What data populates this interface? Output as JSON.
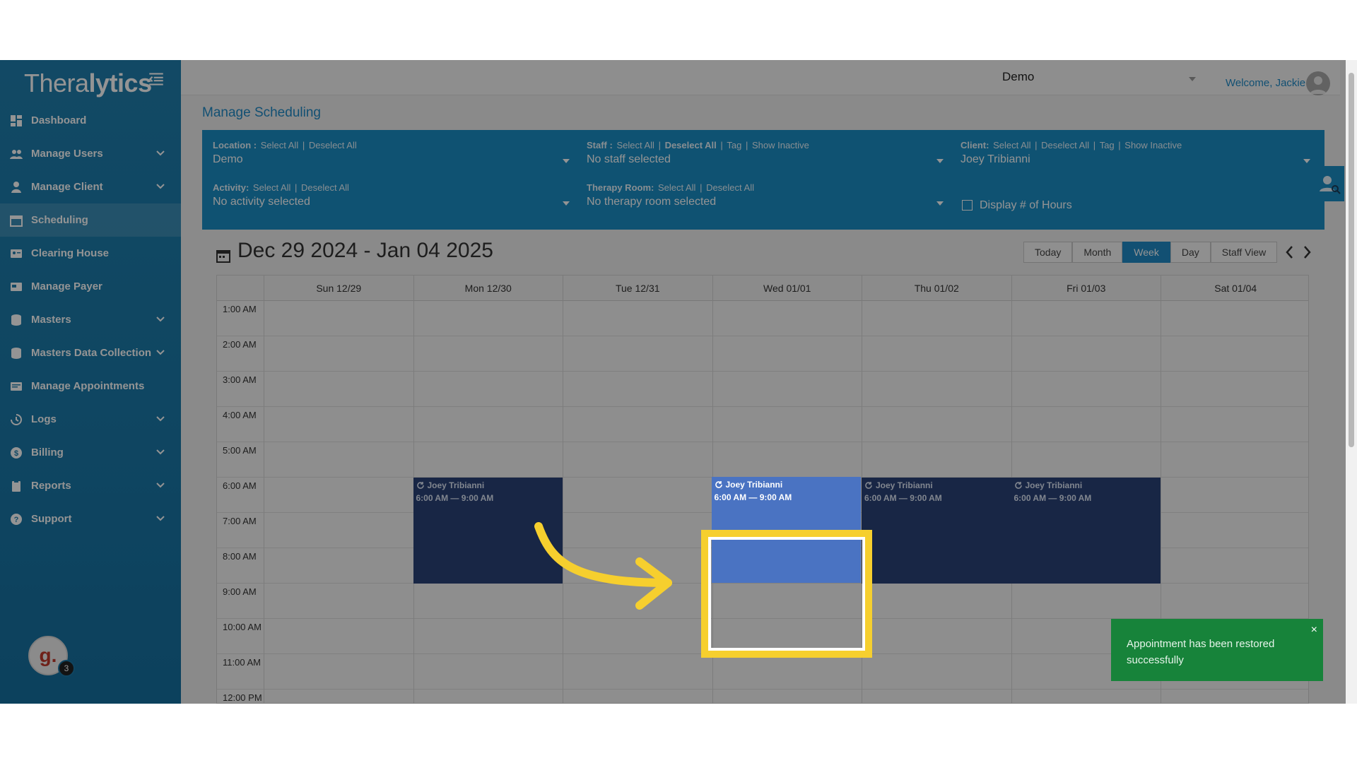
{
  "sidebar": {
    "logo": {
      "thin": "Thera",
      "bold": "lytics"
    },
    "items": [
      {
        "label": "Dashboard",
        "icon": "dashboard-icon",
        "expandable": false
      },
      {
        "label": "Manage Users",
        "icon": "users-icon",
        "expandable": true
      },
      {
        "label": "Manage Client",
        "icon": "user-icon",
        "expandable": true
      },
      {
        "label": "Scheduling",
        "icon": "calendar-icon",
        "expandable": false,
        "active": true
      },
      {
        "label": "Clearing House",
        "icon": "id-card-icon",
        "expandable": false
      },
      {
        "label": "Manage Payer",
        "icon": "payer-icon",
        "expandable": false
      },
      {
        "label": "Masters",
        "icon": "database-icon",
        "expandable": true
      },
      {
        "label": "Masters Data Collection",
        "icon": "database-icon",
        "expandable": true
      },
      {
        "label": "Manage Appointments",
        "icon": "appointments-icon",
        "expandable": false
      },
      {
        "label": "Logs",
        "icon": "history-icon",
        "expandable": true
      },
      {
        "label": "Billing",
        "icon": "dollar-icon",
        "expandable": true
      },
      {
        "label": "Reports",
        "icon": "clipboard-icon",
        "expandable": true
      },
      {
        "label": "Support",
        "icon": "question-icon",
        "expandable": true
      }
    ],
    "notification_badge": "3",
    "assistant_letter": "g."
  },
  "topbar": {
    "org": "Demo",
    "welcome": "Welcome, Jackie"
  },
  "page": {
    "title": "Manage Scheduling"
  },
  "filters": {
    "location": {
      "label": "Location :",
      "select_all": "Select All",
      "deselect_all": "Deselect All",
      "value": "Demo"
    },
    "staff": {
      "label": "Staff :",
      "select_all": "Select All",
      "deselect_all": "Deselect All",
      "tag": "Tag",
      "show_inactive": "Show Inactive",
      "value": "No staff selected"
    },
    "client": {
      "label": "Client:",
      "select_all": "Select All",
      "deselect_all": "Deselect All",
      "tag": "Tag",
      "show_inactive": "Show Inactive",
      "value": "Joey Tribianni"
    },
    "activity": {
      "label": "Activity:",
      "select_all": "Select All",
      "deselect_all": "Deselect All",
      "value": "No activity selected"
    },
    "room": {
      "label": "Therapy Room:",
      "select_all": "Select All",
      "deselect_all": "Deselect All",
      "value": "No therapy room selected"
    },
    "display_hours": {
      "label": "Display # of Hours",
      "checked": false
    }
  },
  "calendar": {
    "range_title": "Dec 29 2024 - Jan 04 2025",
    "views": [
      "Today",
      "Month",
      "Week",
      "Day",
      "Staff View"
    ],
    "active_view": "Week",
    "days": [
      "Sun 12/29",
      "Mon 12/30",
      "Tue 12/31",
      "Wed 01/01",
      "Thu 01/02",
      "Fri 01/03",
      "Sat 01/04"
    ],
    "times": [
      "1:00 AM",
      "2:00 AM",
      "3:00 AM",
      "4:00 AM",
      "5:00 AM",
      "6:00 AM",
      "7:00 AM",
      "8:00 AM",
      "9:00 AM",
      "10:00 AM",
      "11:00 AM",
      "12:00 PM"
    ],
    "events": [
      {
        "day": 1,
        "name": "Joey Tribianni",
        "time": "6:00 AM — 9:00 AM",
        "highlighted": false
      },
      {
        "day": 3,
        "name": "Joey Tribianni",
        "time": "6:00 AM — 9:00 AM",
        "highlighted": true
      },
      {
        "day": 4,
        "name": "Joey Tribianni",
        "time": "6:00 AM — 9:00 AM",
        "highlighted": false
      },
      {
        "day": 5,
        "name": "Joey Tribianni",
        "time": "6:00 AM — 9:00 AM",
        "highlighted": false
      }
    ]
  },
  "toast": {
    "message": "Appointment has been restored successfully",
    "close": "×"
  },
  "colors": {
    "primary": "#1b8dc4",
    "event": "#2a4378",
    "event_highlight": "#4a73c2",
    "highlight_box": "#f6cf2e",
    "toast": "#17833a"
  }
}
